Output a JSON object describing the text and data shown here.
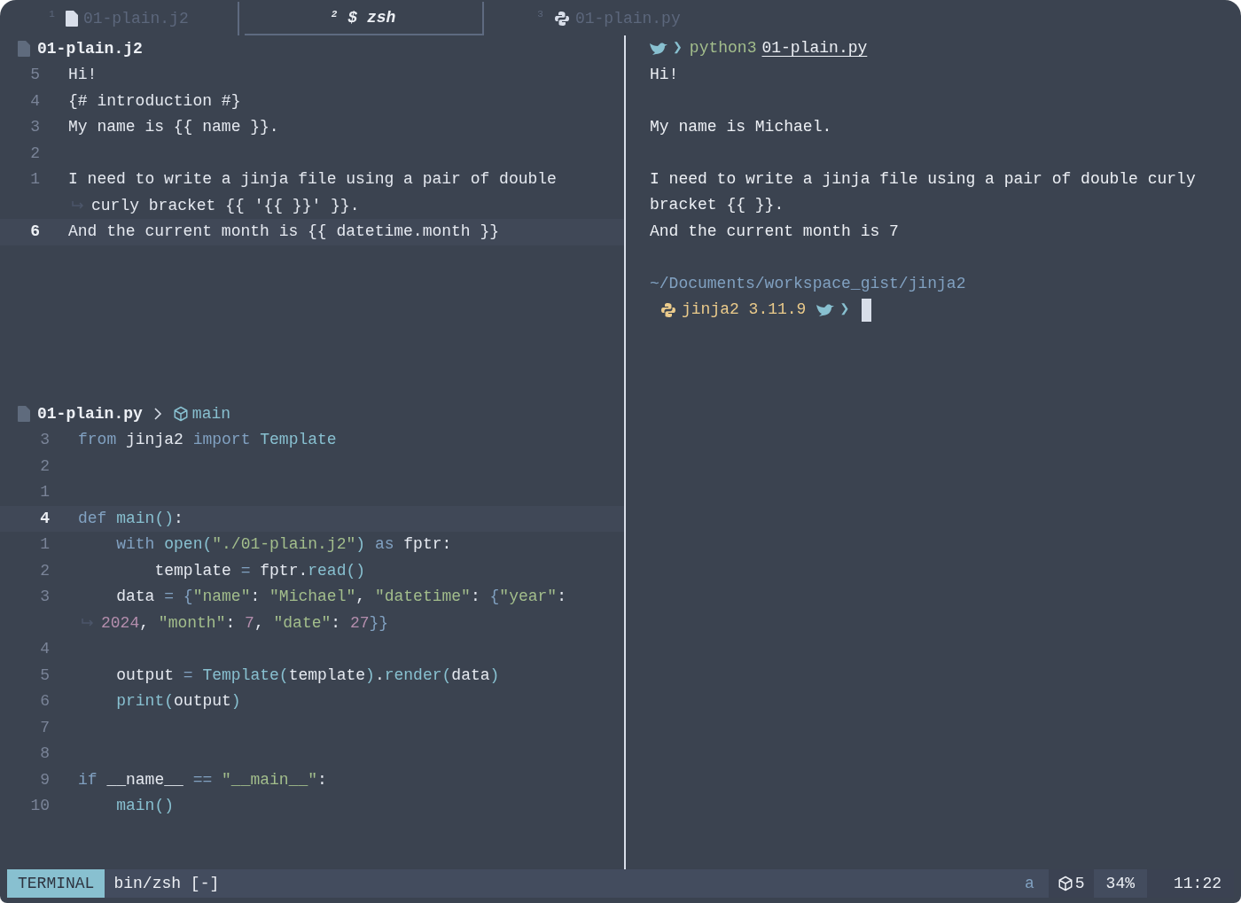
{
  "tabs": [
    {
      "number": "1",
      "kind": "file",
      "label": "01-plain.j2",
      "selected": false
    },
    {
      "number": "2",
      "kind": "terminal",
      "label": "$ zsh",
      "selected": true
    },
    {
      "number": "3",
      "kind": "python",
      "label": "01-plain.py",
      "selected": false
    }
  ],
  "template_editor": {
    "title": "01-plain.j2",
    "lines": [
      {
        "number": "5",
        "current": false,
        "text": "Hi!"
      },
      {
        "number": "4",
        "current": false,
        "text": "{# introduction #}"
      },
      {
        "number": "3",
        "current": false,
        "text": "My name is {{ name }}."
      },
      {
        "number": "2",
        "current": false
      },
      {
        "number": "1",
        "current": false,
        "text": "I need to write a jinja file using a pair of double"
      },
      {
        "continuation": true,
        "current": false,
        "text": "curly bracket {{ '{{ }}' }}."
      },
      {
        "number": "6",
        "current": true,
        "text": "And the current month is {{ datetime.month }}"
      }
    ]
  },
  "python_editor": {
    "title": "01-plain.py",
    "breadcrumb": "main",
    "lines": [
      {
        "number": "3",
        "current": false,
        "tokens": [
          {
            "kind": "keyword",
            "text": "from"
          },
          {
            "kind": "text",
            "text": " jinja2 "
          },
          {
            "kind": "keyword",
            "text": "import"
          },
          {
            "kind": "function",
            "text": " Template"
          }
        ]
      },
      {
        "number": "2",
        "current": false
      },
      {
        "number": "1",
        "current": false
      },
      {
        "number": "4",
        "current": true,
        "tokens": [
          {
            "kind": "keyword",
            "text": "def"
          },
          {
            "kind": "function",
            "text": " main()"
          },
          {
            "kind": "text",
            "text": ":"
          }
        ]
      },
      {
        "number": "1",
        "current": false,
        "tokens": [
          {
            "kind": "keyword",
            "text": "    with"
          },
          {
            "kind": "function",
            "text": " open("
          },
          {
            "kind": "string",
            "text": "\"./01-plain.j2\""
          },
          {
            "kind": "function",
            "text": ")"
          },
          {
            "kind": "keyword",
            "text": " as"
          },
          {
            "kind": "text",
            "text": " fptr:"
          }
        ]
      },
      {
        "number": "2",
        "current": false,
        "tokens": [
          {
            "kind": "text",
            "text": "        template"
          },
          {
            "kind": "operator",
            "text": " = "
          },
          {
            "kind": "text",
            "text": "fptr."
          },
          {
            "kind": "function",
            "text": "read()"
          }
        ]
      },
      {
        "number": "3",
        "current": false,
        "tokens": [
          {
            "kind": "text",
            "text": "    data"
          },
          {
            "kind": "operator",
            "text": " = {"
          },
          {
            "kind": "string",
            "text": "\"name\""
          },
          {
            "kind": "text",
            "text": ": "
          },
          {
            "kind": "string",
            "text": "\"Michael\""
          },
          {
            "kind": "text",
            "text": ", "
          },
          {
            "kind": "string",
            "text": "\"datetime\""
          },
          {
            "kind": "text",
            "text": ": "
          },
          {
            "kind": "operator",
            "text": "{"
          },
          {
            "kind": "string",
            "text": "\"year\""
          },
          {
            "kind": "text",
            "text": ":"
          }
        ]
      },
      {
        "continuation": true,
        "current": false,
        "tokens": [
          {
            "kind": "number",
            "text": "2024"
          },
          {
            "kind": "text",
            "text": ", "
          },
          {
            "kind": "string",
            "text": "\"month\""
          },
          {
            "kind": "text",
            "text": ": "
          },
          {
            "kind": "number",
            "text": "7"
          },
          {
            "kind": "text",
            "text": ", "
          },
          {
            "kind": "string",
            "text": "\"date\""
          },
          {
            "kind": "text",
            "text": ": "
          },
          {
            "kind": "number",
            "text": "27"
          },
          {
            "kind": "operator",
            "text": "}}"
          }
        ]
      },
      {
        "number": "4",
        "current": false
      },
      {
        "number": "5",
        "current": false,
        "tokens": [
          {
            "kind": "text",
            "text": "    output"
          },
          {
            "kind": "operator",
            "text": " = "
          },
          {
            "kind": "function",
            "text": "Template("
          },
          {
            "kind": "text",
            "text": "template"
          },
          {
            "kind": "function",
            "text": ")"
          },
          {
            "kind": "text",
            "text": "."
          },
          {
            "kind": "function",
            "text": "render("
          },
          {
            "kind": "text",
            "text": "data"
          },
          {
            "kind": "function",
            "text": ")"
          }
        ]
      },
      {
        "number": "6",
        "current": false,
        "tokens": [
          {
            "kind": "function",
            "text": "    print("
          },
          {
            "kind": "text",
            "text": "output"
          },
          {
            "kind": "function",
            "text": ")"
          }
        ]
      },
      {
        "number": "7",
        "current": false
      },
      {
        "number": "8",
        "current": false
      },
      {
        "number": "9",
        "current": false,
        "tokens": [
          {
            "kind": "keyword",
            "text": "if"
          },
          {
            "kind": "text",
            "text": " __name__ "
          },
          {
            "kind": "operator",
            "text": "=="
          },
          {
            "kind": "string",
            "text": " \"__main__\""
          },
          {
            "kind": "text",
            "text": ":"
          }
        ]
      },
      {
        "number": "10",
        "current": false,
        "tokens": [
          {
            "kind": "function",
            "text": "    main()"
          }
        ]
      }
    ]
  },
  "terminal": {
    "lines": [
      {
        "kind": "command",
        "chevron": "❯",
        "program": "python3",
        "argument": "01-plain.py"
      },
      {
        "kind": "output",
        "text": "Hi!"
      },
      {
        "kind": "blank"
      },
      {
        "kind": "output",
        "text": "My name is Michael."
      },
      {
        "kind": "blank"
      },
      {
        "kind": "output",
        "text": "I need to write a jinja file using a pair of double curly"
      },
      {
        "kind": "output",
        "text": "bracket {{ }}."
      },
      {
        "kind": "output",
        "text": "And the current month is 7"
      },
      {
        "kind": "blank"
      },
      {
        "kind": "path",
        "text": "~/Documents/workspace_gist/jinja2"
      },
      {
        "kind": "prompt",
        "environment": "jinja2 3.11.9",
        "chevron": "❯"
      }
    ]
  },
  "status_bar": {
    "mode": "TERMINAL",
    "file": "bin/zsh [-]",
    "register": "a",
    "count": "5",
    "percent": "34%",
    "time": "11:22"
  }
}
